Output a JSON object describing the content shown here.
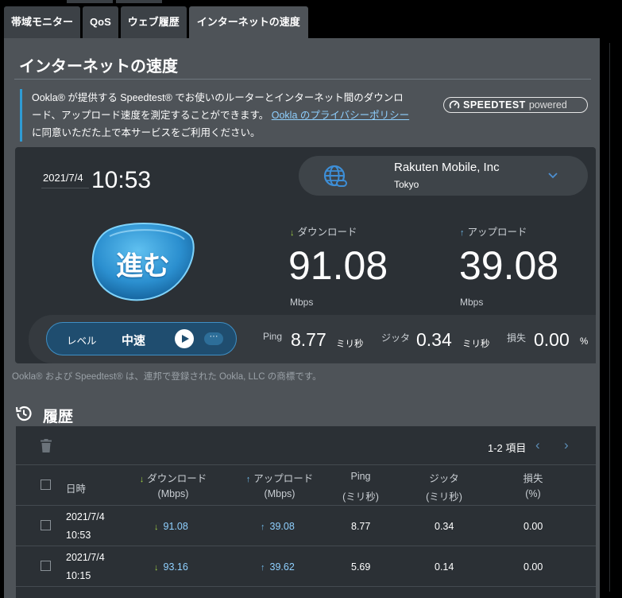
{
  "tabs": [
    {
      "label": "帯域モニター",
      "active": false
    },
    {
      "label": "QoS",
      "active": false
    },
    {
      "label": "ウェブ履歴",
      "active": false
    },
    {
      "label": "インターネットの速度",
      "active": true
    }
  ],
  "page": {
    "title": "インターネットの速度",
    "notice_part1": "Ookla® が提供する Speedtest® でお使いのルーターとインターネット間のダウンロ",
    "notice_part2": "ード、アップロード速度を測定することができます。",
    "notice_link": "Ookla のプライバシーポリシー",
    "notice_part3": "に同意いただた上で本サービスをご利用ください。",
    "logo_main": "SPEEDTEST",
    "logo_sub": "powered",
    "trademark": "Ookla® および Speedtest® は、連邦で登録された Ookla, LLC の商標です。"
  },
  "test": {
    "date": "2021/7/4",
    "time": "10:53",
    "server_name": "Rakuten Mobile, Inc",
    "server_city": "Tokyo",
    "go_label": "進む",
    "download_label": "ダウンロード",
    "download_value": "91.08",
    "download_unit": "Mbps",
    "upload_label": "アップロード",
    "upload_value": "39.08",
    "upload_unit": "Mbps",
    "level_label": "レベル",
    "level_value": "中速",
    "more_label": "···",
    "ping_label": "Ping",
    "ping_value": "8.77",
    "ping_unit": "ミリ秒",
    "jitter_label": "ジッタ",
    "jitter_value": "0.34",
    "jitter_unit": "ミリ秒",
    "loss_label": "損失",
    "loss_value": "0.00",
    "loss_unit": "%"
  },
  "history": {
    "title": "履歴",
    "pager": "1-2 項目",
    "columns": {
      "date": "日時",
      "download": "ダウンロード",
      "download_unit": "(Mbps)",
      "upload": "アップロード",
      "upload_unit": "(Mbps)",
      "ping": "Ping",
      "ping_unit": "(ミリ秒)",
      "jitter": "ジッタ",
      "jitter_unit": "(ミリ秒)",
      "loss": "損失",
      "loss_unit": "(%)"
    },
    "rows": [
      {
        "date": "2021/7/4",
        "time": "10:53",
        "download": "91.08",
        "upload": "39.08",
        "ping": "8.77",
        "jitter": "0.34",
        "loss": "0.00"
      },
      {
        "date": "2021/7/4",
        "time": "10:15",
        "download": "93.16",
        "upload": "39.62",
        "ping": "5.69",
        "jitter": "0.14",
        "loss": "0.00"
      }
    ]
  },
  "colors": {
    "accent": "#2f9bd4",
    "download_arrow": "#9fcf45",
    "upload_arrow": "#6fb7e6",
    "panel": "#4e5358",
    "card": "#2b3035"
  }
}
